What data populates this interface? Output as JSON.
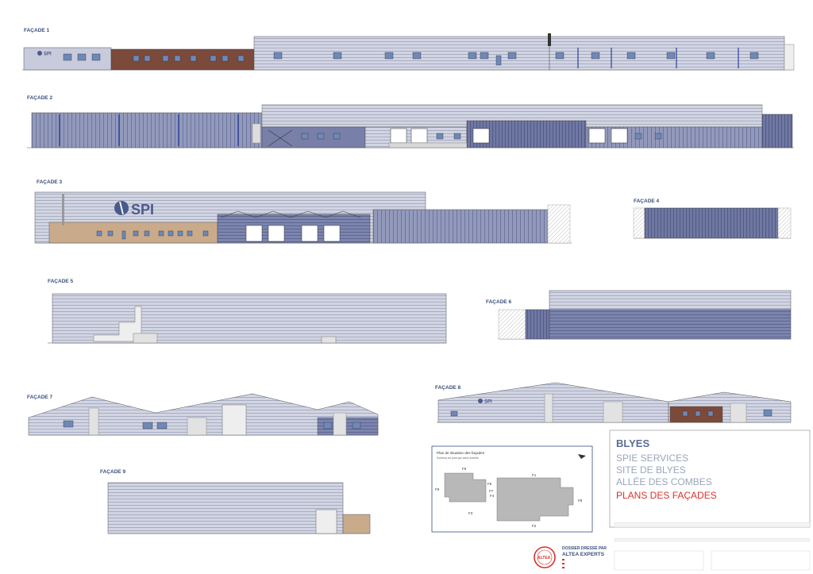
{
  "facades": [
    {
      "id": "f1",
      "label": "FAÇADE 1"
    },
    {
      "id": "f2",
      "label": "FAÇADE 2"
    },
    {
      "id": "f3",
      "label": "FAÇADE 3"
    },
    {
      "id": "f4",
      "label": "FAÇADE 4"
    },
    {
      "id": "f5",
      "label": "FAÇADE 5"
    },
    {
      "id": "f6",
      "label": "FAÇADE 6"
    },
    {
      "id": "f7",
      "label": "FAÇADE 7"
    },
    {
      "id": "f8",
      "label": "FAÇADE 8"
    },
    {
      "id": "f9",
      "label": "FAÇADE 9"
    }
  ],
  "brand": {
    "logo_text": "SPI"
  },
  "situation_plan": {
    "title": "Plan de situation des façades",
    "subtitle": "Schéma de principe sans échelle",
    "labels": [
      "F1",
      "F2",
      "F3",
      "F4",
      "F5",
      "F6",
      "F7",
      "F8",
      "F9"
    ]
  },
  "title_block": {
    "line1": "BLYES",
    "line2": "SPIE SERVICES",
    "line3": "SITE DE BLYES",
    "line4": "ALLÉE DES COMBES",
    "line5": "PLANS DES FAÇADES"
  },
  "stamp": {
    "line1": "DOSSIER DRESSÉ PAR",
    "line2": "ALTEA EXPERTS",
    "seal_text": "ALTEA"
  },
  "colors": {
    "label_blue": "#3a4f7a",
    "cladding": "#8f97b8",
    "cladding_dark": "#5f6a96",
    "brick": "#7b4a3a",
    "tan": "#c9ab8c",
    "title_blue": "#5a6d92",
    "title_grey": "#9aa6bc",
    "title_red": "#d8332b"
  }
}
